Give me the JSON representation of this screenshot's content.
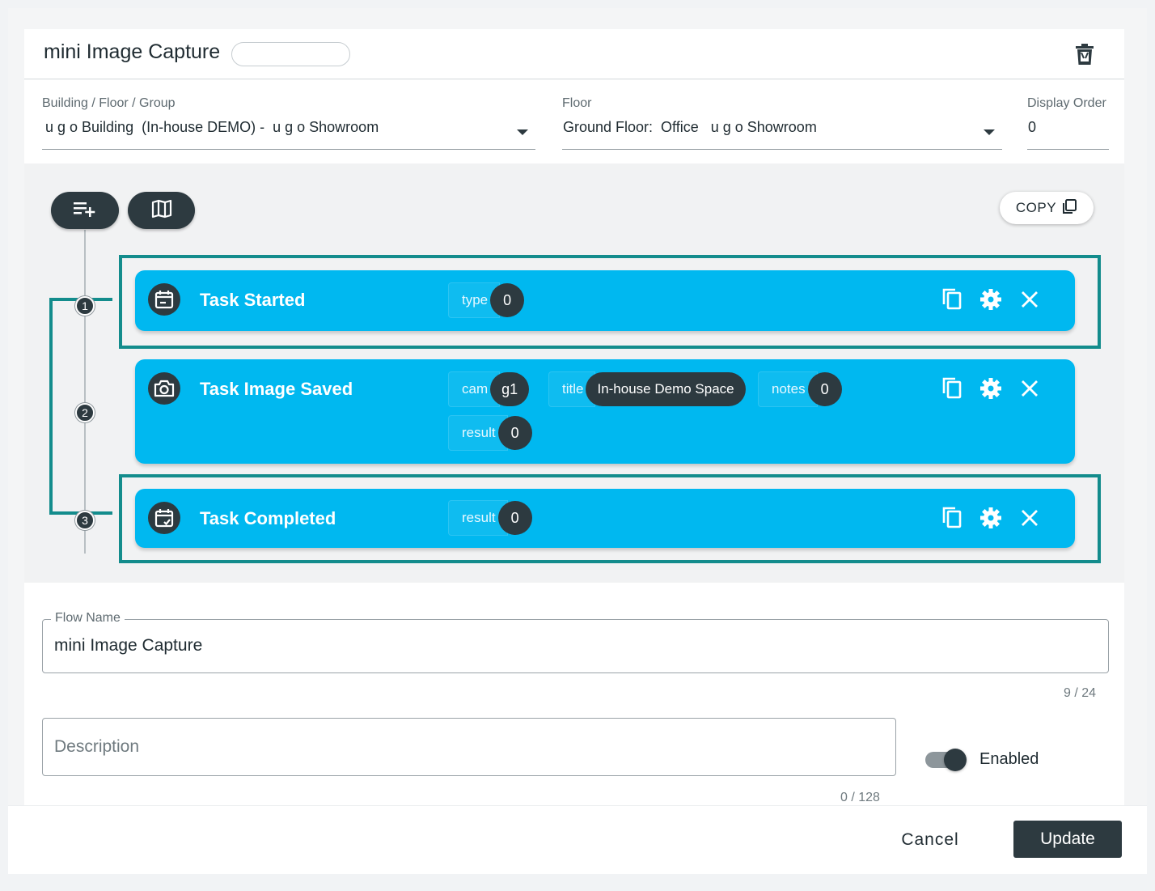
{
  "header": {
    "title": "mini Image Capture"
  },
  "location": {
    "group_label": "Building / Floor / Group",
    "group_value": "u g o Building  (In-house DEMO) -  u g o Showroom",
    "floor_label": "Floor",
    "floor_value": "Ground Floor:  Office   u g o Showroom",
    "order_label": "Display Order",
    "order_value": "0"
  },
  "toolbar": {
    "copy_label": "COPY"
  },
  "steps": [
    "1",
    "2",
    "3"
  ],
  "tasks": [
    {
      "name": "Task Started",
      "icon": "calendar-start-icon",
      "params": [
        {
          "key": "type",
          "value": "0"
        }
      ]
    },
    {
      "name": "Task Image Saved",
      "icon": "camera-icon",
      "params": [
        {
          "key": "cam",
          "value": "g1"
        },
        {
          "key": "title",
          "value": "In-house Demo Space"
        },
        {
          "key": "notes",
          "value": "0"
        },
        {
          "key": "result",
          "value": "0"
        }
      ]
    },
    {
      "name": "Task Completed",
      "icon": "calendar-check-icon",
      "params": [
        {
          "key": "result",
          "value": "0"
        }
      ]
    }
  ],
  "form": {
    "flow_name_label": "Flow Name",
    "flow_name_value": "mini Image Capture",
    "flow_name_counter": "9 / 24",
    "description_placeholder": "Description",
    "description_counter": "0 / 128",
    "enabled_label": "Enabled",
    "enabled": true
  },
  "footer": {
    "cancel_label": "Cancel",
    "update_label": "Update"
  },
  "colors": {
    "task_bg": "#00b8f0",
    "accent_dark": "#2d3a40",
    "selection": "#138c8c"
  }
}
